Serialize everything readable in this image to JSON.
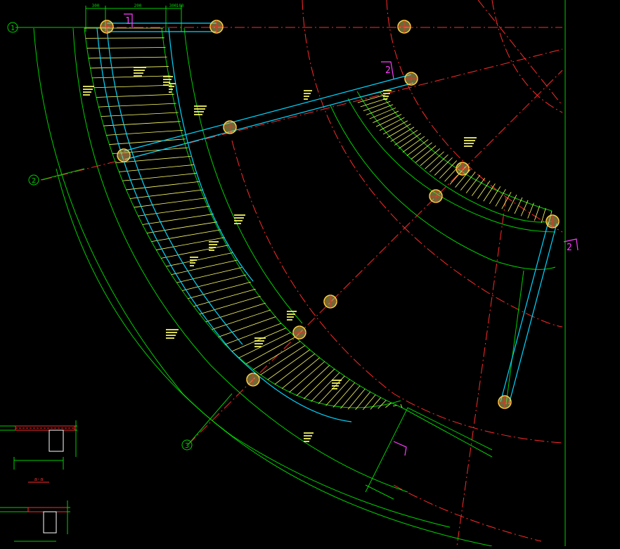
{
  "colors": {
    "background": "#000000",
    "grid_axis": "#ff2a2a",
    "dimension": "#00d000",
    "beam": "#00d8ff",
    "tread": "#ffff66",
    "column": "#c8c060",
    "note": "#ff3cff",
    "section": "#ff2a2a"
  },
  "axis_bubbles": {
    "a1": "1",
    "a2": "2",
    "a3": "3"
  },
  "section_markers": {
    "m1": "1",
    "m2": "2",
    "m3": "2"
  },
  "top_dims": {
    "d1": "300",
    "d2": "200",
    "d3": "300",
    "d4": "100"
  },
  "section_detail": {
    "title_a": "a-a"
  }
}
